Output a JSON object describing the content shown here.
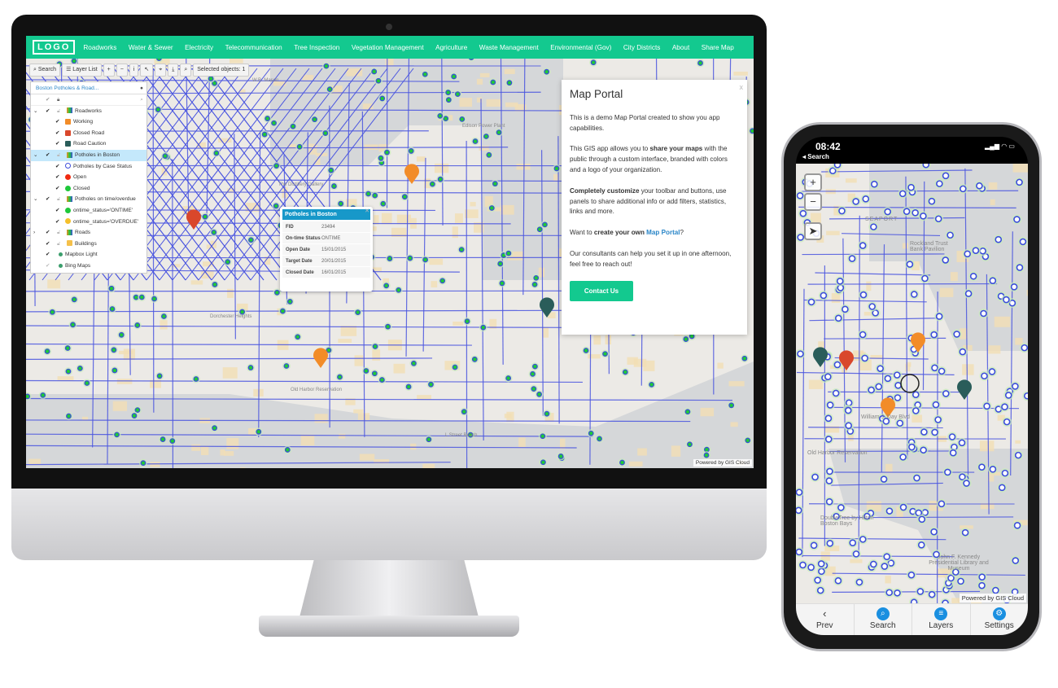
{
  "desktop": {
    "logo": "LOGO",
    "nav": [
      "Roadworks",
      "Water & Sewer",
      "Electricity",
      "Telecommunication",
      "Tree Inspection",
      "Vegetation Management",
      "Agriculture",
      "Waste Management",
      "Environmental (Gov)",
      "City Districts",
      "About",
      "Share Map"
    ],
    "toolbar": {
      "search": "Search",
      "layer_list": "Layer List",
      "zoom_in": "+",
      "zoom_out": "−",
      "info": "i",
      "select": "↖",
      "locate": "⌖",
      "download": "⤓",
      "zoom_box": "⌕",
      "selected": "Selected objects: 1"
    },
    "layer_panel": {
      "title": "Boston Potholes & Road...",
      "layers": [
        {
          "label": "Roadworks",
          "type": "group",
          "expanded": true
        },
        {
          "label": "Working",
          "type": "item",
          "color": "#f28c28"
        },
        {
          "label": "Closed Road",
          "type": "item",
          "color": "#d9472b"
        },
        {
          "label": "Road Caution",
          "type": "item",
          "color": "#2a5d5a"
        },
        {
          "label": "Potholes in Boston",
          "type": "group",
          "expanded": true,
          "selected": true
        },
        {
          "label": "Potholes by Case Status",
          "type": "item",
          "color": "#3d4ddb",
          "hollow": true
        },
        {
          "label": "Open",
          "type": "item",
          "color": "#f02a10"
        },
        {
          "label": "Closed",
          "type": "item",
          "color": "#1ec83a"
        },
        {
          "label": "Potholes on time/overdue",
          "type": "group",
          "expanded": true
        },
        {
          "label": "ontime_status='ONTIME'",
          "type": "item",
          "color": "#1ec83a"
        },
        {
          "label": "ontime_status='OVERDUE'",
          "type": "item",
          "color": "#f5c02a"
        },
        {
          "label": "Roads",
          "type": "group",
          "expanded": false
        },
        {
          "label": "Buildings",
          "type": "layer",
          "color": "#f5c04a"
        },
        {
          "label": "Mapbox Light",
          "type": "base"
        },
        {
          "label": "Bing Maps",
          "type": "base"
        }
      ]
    },
    "popup": {
      "title": "Potholes in Boston",
      "rows": [
        {
          "key": "FID",
          "value": "23494"
        },
        {
          "key": "On-time Status",
          "value": "ONTIME"
        },
        {
          "key": "Open Date",
          "value": "15/01/2015"
        },
        {
          "key": "Target Date",
          "value": "20/01/2015"
        },
        {
          "key": "Closed Date",
          "value": "16/01/2015"
        }
      ]
    },
    "portal": {
      "title": "Map Portal",
      "close": "x",
      "p1": "This is a demo Map Portal created to show you app capabilities.",
      "p2_pre": "This GIS app allows you to ",
      "p2_bold": "share your maps",
      "p2_post": " with the public through a custom interface, branded with colors and a logo of your organization.",
      "p3_bold": "Completely customize",
      "p3_post": " your toolbar and buttons, use panels to share additional info or add filters, statistics, links and more.",
      "p4_pre": "Want to ",
      "p4_bold": "create your own ",
      "p4_link": "Map Portal",
      "p4_post": "?",
      "p5": "Our consultants can help you set it up in one afternoon, feel free to reach out!",
      "button": "Contact Us"
    },
    "map_labels": [
      "W.B. Mason",
      "Edison Power Plant",
      "The Distillery Gallery",
      "Dorchester Heights",
      "Old Harbor Reservation",
      "L Street Beach"
    ],
    "credit": "Powered by GIS Cloud"
  },
  "phone": {
    "time": "08:42",
    "back": "◂ Search",
    "zoom_in": "+",
    "zoom_out": "−",
    "map_labels": [
      "SEAPORT",
      "Rockland Trust Bank Pavilion",
      "Old Harbor Reservation",
      "DoubleTree by Hilton Boston Bays",
      "John F. Kennedy Presidential Library and Museum",
      "William J. Day Blvd"
    ],
    "credit": "Powered by GIS Cloud",
    "tabs": [
      {
        "label": "Prev",
        "icon": "chevron-left-icon"
      },
      {
        "label": "Search",
        "icon": "search-icon"
      },
      {
        "label": "Layers",
        "icon": "layers-icon"
      },
      {
        "label": "Settings",
        "icon": "gear-icon"
      }
    ]
  },
  "colors": {
    "brand": "#13c98f",
    "road": "#4a55e0",
    "popup_header": "#1798c9",
    "link": "#2a86c8"
  }
}
